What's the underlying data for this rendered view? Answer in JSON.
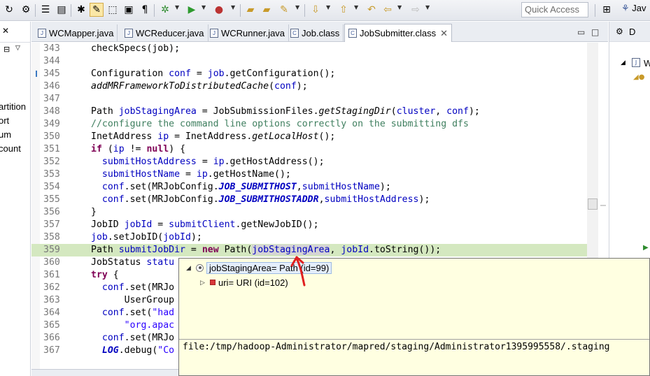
{
  "toolbar": {
    "quick_access_placeholder": "Quick Access",
    "perspective_label": "Jav"
  },
  "left_panel": {
    "fragments": [
      "artition",
      "ort",
      "um",
      "count"
    ]
  },
  "tabs": [
    {
      "label": "WCMapper.java",
      "active": false
    },
    {
      "label": "WCReducer.java",
      "active": false
    },
    {
      "label": "WCRunner.java",
      "active": false
    },
    {
      "label": "Job.class",
      "active": false
    },
    {
      "label": "JobSubmitter.class",
      "active": true
    }
  ],
  "tab_close_glyph": "✕",
  "right_panel": {
    "tab_label": "D",
    "tree_label": "W"
  },
  "code_lines": [
    {
      "n": "343",
      "text": "checkSpecs(job);"
    },
    {
      "n": "344",
      "text": ""
    },
    {
      "n": "345",
      "text": "Configuration conf = job.getConfiguration();"
    },
    {
      "n": "346",
      "text": "addMRFrameworkToDistributedCache(conf);"
    },
    {
      "n": "347",
      "text": ""
    },
    {
      "n": "348",
      "text": "Path jobStagingArea = JobSubmissionFiles.getStagingDir(cluster, conf);"
    },
    {
      "n": "349",
      "text": "//configure the command line options correctly on the submitting dfs"
    },
    {
      "n": "350",
      "text": "InetAddress ip = InetAddress.getLocalHost();"
    },
    {
      "n": "351",
      "text": "if (ip != null) {"
    },
    {
      "n": "352",
      "text": "  submitHostAddress = ip.getHostAddress();"
    },
    {
      "n": "353",
      "text": "  submitHostName = ip.getHostName();"
    },
    {
      "n": "354",
      "text": "  conf.set(MRJobConfig.JOB_SUBMITHOST,submitHostName);"
    },
    {
      "n": "355",
      "text": "  conf.set(MRJobConfig.JOB_SUBMITHOSTADDR,submitHostAddress);"
    },
    {
      "n": "356",
      "text": "}"
    },
    {
      "n": "357",
      "text": "JobID jobId = submitClient.getNewJobID();"
    },
    {
      "n": "358",
      "text": "job.setJobID(jobId);"
    },
    {
      "n": "359",
      "text": "Path submitJobDir = new Path(jobStagingArea, jobId.toString());"
    },
    {
      "n": "360",
      "text": "JobStatus statu"
    },
    {
      "n": "361",
      "text": "try {"
    },
    {
      "n": "362",
      "text": "  conf.set(MRJo"
    },
    {
      "n": "363",
      "text": "      UserGroup"
    },
    {
      "n": "364",
      "text": "  conf.set(\"had"
    },
    {
      "n": "365",
      "text": "      \"org.apac"
    },
    {
      "n": "366",
      "text": "  conf.set(MRJo"
    },
    {
      "n": "367",
      "text": "  LOG.debug(\"Co"
    }
  ],
  "popup": {
    "root_label": "jobStagingArea= Path  (id=99)",
    "child_label": "uri= URI  (id=102)",
    "detail_value": "file:/tmp/hadoop-Administrator/mapred/staging/Administrator1395995558/.staging"
  }
}
